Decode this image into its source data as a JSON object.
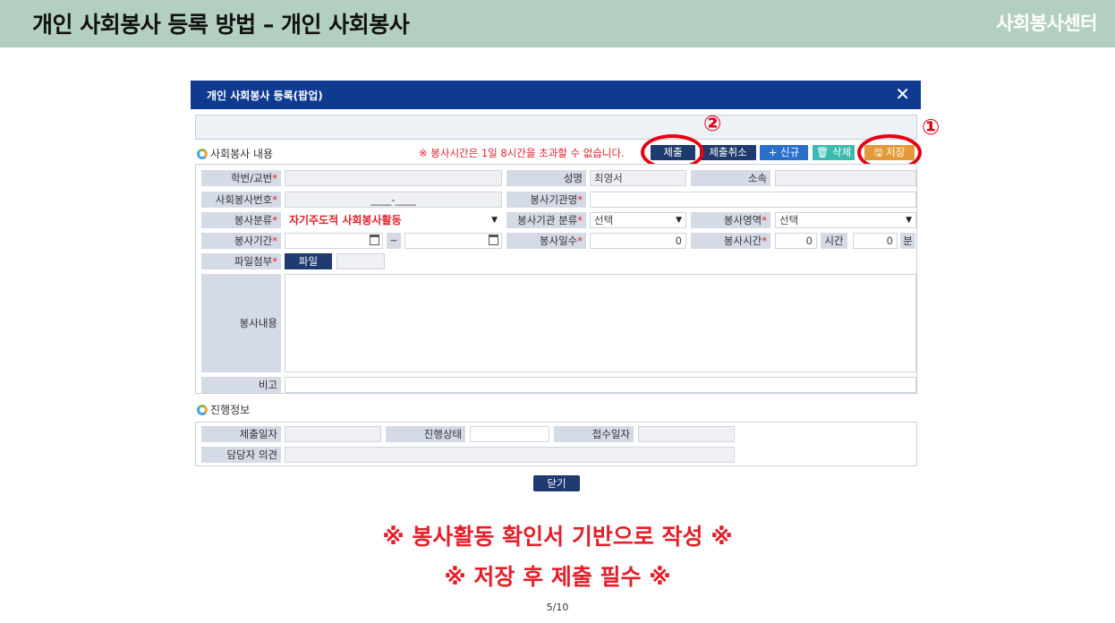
{
  "header": {
    "title": "개인 사회봉사 등록 방법 – 개인 사회봉사",
    "brand": "사회봉사센터"
  },
  "popup": {
    "title": "개인 사회봉사 등록(팝업)",
    "close_icon": "close-icon"
  },
  "section_content": {
    "label": "사회봉사 내용"
  },
  "notice": "※ 봉사시간은 1일 8시간을 초과할 수 없습니다.",
  "toolbar": {
    "submit": "제출",
    "submit_cancel": "제출취소",
    "new": "+ 신규",
    "delete": "🗑 삭제",
    "save": "🖫 저장"
  },
  "annotations": {
    "one": "①",
    "two": "②"
  },
  "form": {
    "student_id_label": "학번/교번",
    "name_label": "성명",
    "name_value": "최영서",
    "affiliation_label": "소속",
    "service_no_label": "사회봉사번호",
    "service_no_value": "____-____",
    "org_name_label": "봉사기관명",
    "category_label": "봉사분류",
    "category_value": "자기주도적 사회봉사활동",
    "org_type_label": "봉사기관 분류",
    "org_type_value": "선택",
    "area_label": "봉사영역",
    "area_value": "선택",
    "period_label": "봉사기간",
    "tilde": "~",
    "days_label": "봉사일수",
    "days_value": "0",
    "hours_label": "봉사시간",
    "hours_value": "0",
    "hours_unit": "시간",
    "minutes_value": "0",
    "minutes_unit": "분",
    "attach_label": "파일첨부",
    "file_button": "파일",
    "content_label": "봉사내용",
    "remark_label": "비고"
  },
  "section_progress": {
    "label": "진행정보"
  },
  "progress": {
    "submit_date_label": "제출일자",
    "status_label": "진행상태",
    "receipt_date_label": "접수일자",
    "opinion_label": "담당자 의견"
  },
  "close_button": "닫기",
  "notes": {
    "line1": "※ 봉사활동 확인서 기반으로 작성 ※",
    "line2": "※ 저장 후 제출 필수 ※"
  },
  "page": "5/10",
  "colors": {
    "header_bg": "#b3cfc0",
    "popup_bar": "#0e3a8f",
    "accent_red": "#e60012"
  }
}
